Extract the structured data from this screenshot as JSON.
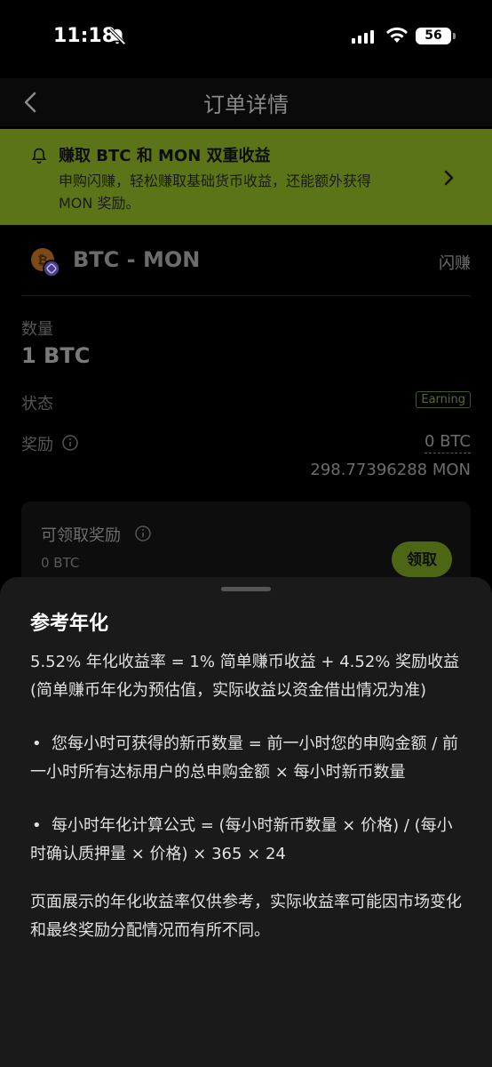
{
  "status_bar": {
    "time": "11:18",
    "battery": "56"
  },
  "header": {
    "title": "订单详情"
  },
  "banner": {
    "title": "赚取 BTC 和 MON 双重收益",
    "description": "申购闪赚，轻松赚取基础货币收益，还能额外获得 MON 奖励。"
  },
  "pair": {
    "name": "BTC - MON",
    "tag": "闪赚"
  },
  "details": {
    "quantity_label": "数量",
    "quantity_value": "1 BTC",
    "status_label": "状态",
    "status_value": "Earning",
    "reward_label": "奖励",
    "reward_btc": "0 BTC",
    "reward_mon": "298.77396288 MON"
  },
  "claim": {
    "title": "可领取奖励",
    "value": "0 BTC",
    "button": "领取"
  },
  "sheet": {
    "title": "参考年化",
    "paragraph1": "5.52% 年化收益率 = 1% 简单赚币收益 + 4.52% 奖励收益 (简单赚币年化为预估值，实际收益以资金借出情况为准)",
    "bullet_symbol": "•",
    "bullet1": "您每小时可获得的新币数量 = 前一小时您的申购金额 / 前一小时所有达标用户的总申购金额 × 每小时新币数量",
    "bullet2": "每小时年化计算公式 = (每小时新币数量 × 价格) / (每小时确认质押量 × 价格) × 365 × 24",
    "paragraph2": "页面展示的年化收益率仅供参考，实际收益率可能因市场变化和最终奖励分配情况而有所不同。"
  },
  "colors": {
    "accent": "#a4d12f",
    "banner_bg": "#5c7418",
    "sheet_bg": "#1a1a1a",
    "page_bg": "#000000"
  }
}
